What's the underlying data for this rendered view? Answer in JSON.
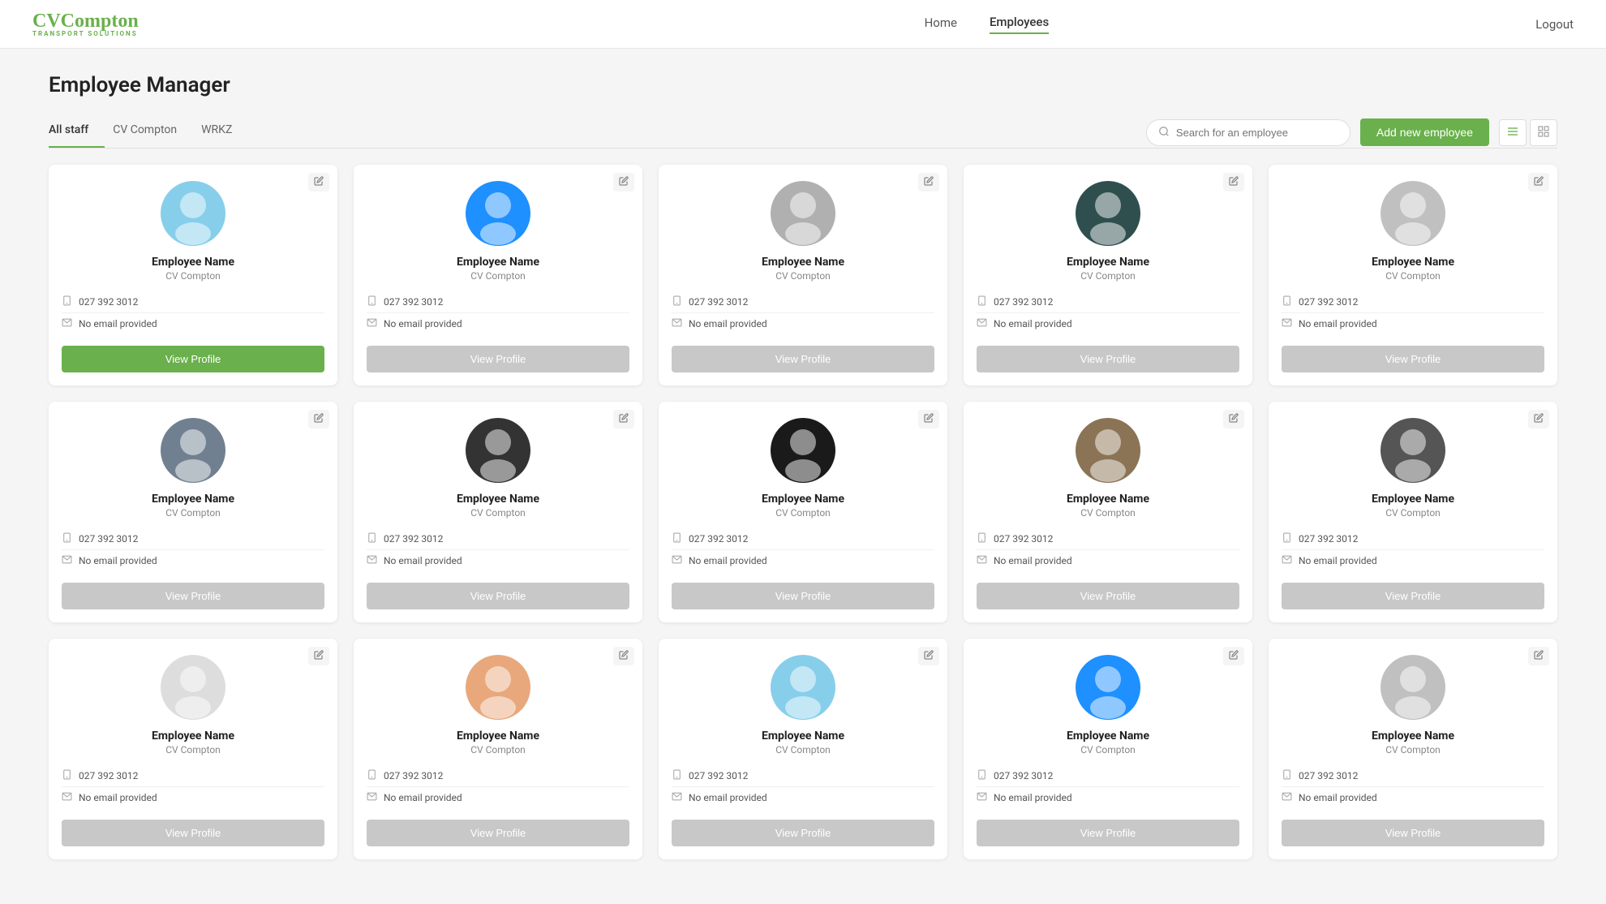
{
  "brand": {
    "name_part1": "CV",
    "name_part2": "Compton",
    "tagline": "TRANSPORT SOLUTIONS"
  },
  "nav": {
    "home": "Home",
    "employees": "Employees",
    "logout": "Logout"
  },
  "page": {
    "title": "Employee Manager"
  },
  "tabs": {
    "items": [
      {
        "label": "All staff",
        "active": true
      },
      {
        "label": "CV Compton",
        "active": false
      },
      {
        "label": "WRKZ",
        "active": false
      }
    ]
  },
  "search": {
    "placeholder": "Search for an employee"
  },
  "toolbar": {
    "add_label": "Add new employee",
    "view_list_title": "List view",
    "view_grid_title": "Grid view"
  },
  "employees": [
    {
      "id": 1,
      "name": "Employee Name",
      "company": "CV Compton",
      "phone": "027 392 3012",
      "email": "No email provided",
      "avatar_color": "av-1",
      "primary": true
    },
    {
      "id": 2,
      "name": "Employee Name",
      "company": "CV Compton",
      "phone": "027 392 3012",
      "email": "No email provided",
      "avatar_color": "av-2",
      "primary": false
    },
    {
      "id": 3,
      "name": "Employee Name",
      "company": "CV Compton",
      "phone": "027 392 3012",
      "email": "No email provided",
      "avatar_color": "av-3",
      "primary": false
    },
    {
      "id": 4,
      "name": "Employee Name",
      "company": "CV Compton",
      "phone": "027 392 3012",
      "email": "No email provided",
      "avatar_color": "av-4",
      "primary": false
    },
    {
      "id": 5,
      "name": "Employee Name",
      "company": "CV Compton",
      "phone": "027 392 3012",
      "email": "No email provided",
      "avatar_color": "av-5",
      "primary": false
    },
    {
      "id": 6,
      "name": "Employee Name",
      "company": "CV Compton",
      "phone": "027 392 3012",
      "email": "No email provided",
      "avatar_color": "av-6",
      "primary": false
    },
    {
      "id": 7,
      "name": "Employee Name",
      "company": "CV Compton",
      "phone": "027 392 3012",
      "email": "No email provided",
      "avatar_color": "av-7",
      "primary": false
    },
    {
      "id": 8,
      "name": "Employee Name",
      "company": "CV Compton",
      "phone": "027 392 3012",
      "email": "No email provided",
      "avatar_color": "av-8",
      "primary": false
    },
    {
      "id": 9,
      "name": "Employee Name",
      "company": "CV Compton",
      "phone": "027 392 3012",
      "email": "No email provided",
      "avatar_color": "av-9",
      "primary": false
    },
    {
      "id": 10,
      "name": "Employee Name",
      "company": "CV Compton",
      "phone": "027 392 3012",
      "email": "No email provided",
      "avatar_color": "av-10",
      "primary": false
    },
    {
      "id": 11,
      "name": "Employee Name",
      "company": "CV Compton",
      "phone": "027 392 3012",
      "email": "No email provided",
      "avatar_color": "av-11",
      "primary": false
    },
    {
      "id": 12,
      "name": "Employee Name",
      "company": "CV Compton",
      "phone": "027 392 3012",
      "email": "No email provided",
      "avatar_color": "av-12",
      "primary": false
    },
    {
      "id": 13,
      "name": "Employee Name",
      "company": "CV Compton",
      "phone": "027 392 3012",
      "email": "No email provided",
      "avatar_color": "av-13",
      "primary": false
    },
    {
      "id": 14,
      "name": "Employee Name",
      "company": "CV Compton",
      "phone": "027 392 3012",
      "email": "No email provided",
      "avatar_color": "av-2",
      "primary": false
    },
    {
      "id": 15,
      "name": "Employee Name",
      "company": "CV Compton",
      "phone": "027 392 3012",
      "email": "No email provided",
      "avatar_color": "av-5",
      "primary": false
    }
  ],
  "card": {
    "view_profile": "View Profile",
    "edit_icon": "✎"
  },
  "colors": {
    "accent": "#6ab04c",
    "btn_secondary": "#c8c8c8"
  }
}
